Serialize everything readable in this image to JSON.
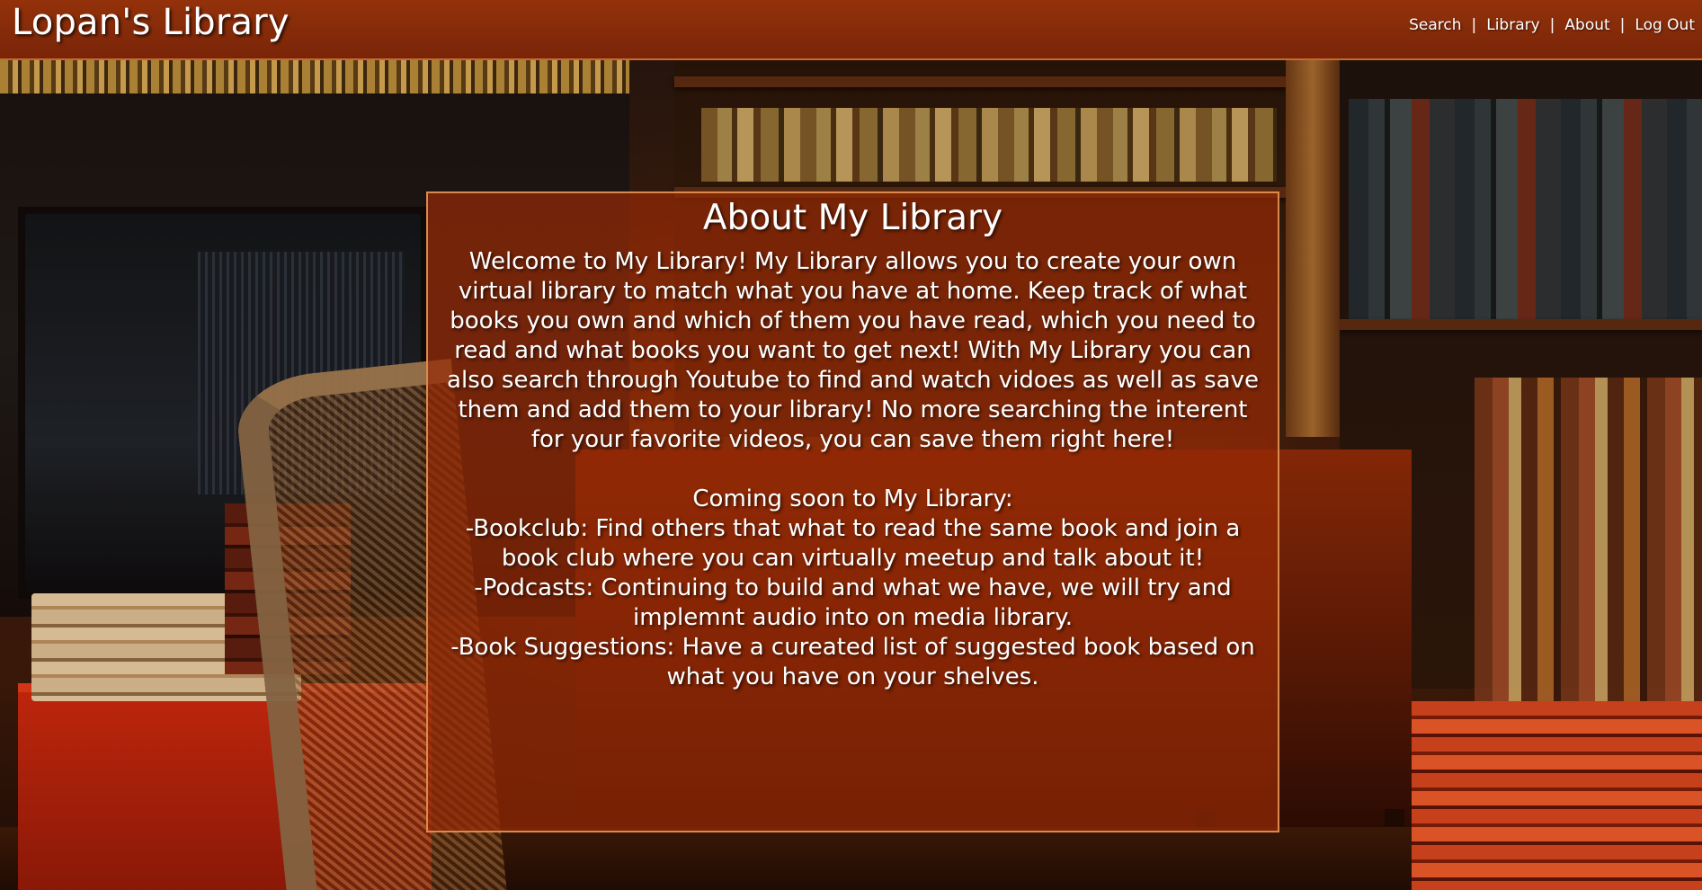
{
  "header": {
    "brand": "Lopan's Library",
    "nav": [
      {
        "label": "Search"
      },
      {
        "label": "Library"
      },
      {
        "label": "About"
      },
      {
        "label": "Log Out"
      }
    ],
    "separator": "|"
  },
  "about": {
    "title": "About My Library",
    "intro": "Welcome to My Library! My Library allows you to create your own virtual library to match what you have at home. Keep track of what books you own and which of them you have read, which you need to read and what books you want to get next! With My Library you can also search through Youtube to find and watch vidoes as well as save them and add them to your library! No more searching the interent for your favorite videos, you can save them right here!",
    "coming_soon_title": "Coming soon to My Library:",
    "coming_soon": [
      "-Bookclub: Find others that what to read the same book and join a book club where you can virtually meetup and talk about it!",
      "-Podcasts: Continuing to build and what we have, we will try and implemnt audio into on media library.",
      "-Book Suggestions: Have a cureated list of suggested book based on what you have on your shelves."
    ]
  },
  "colors": {
    "header_bg": "#9c340a",
    "panel_bg": "#962a06",
    "panel_border": "#d98a4e",
    "text": "#ffffff"
  }
}
